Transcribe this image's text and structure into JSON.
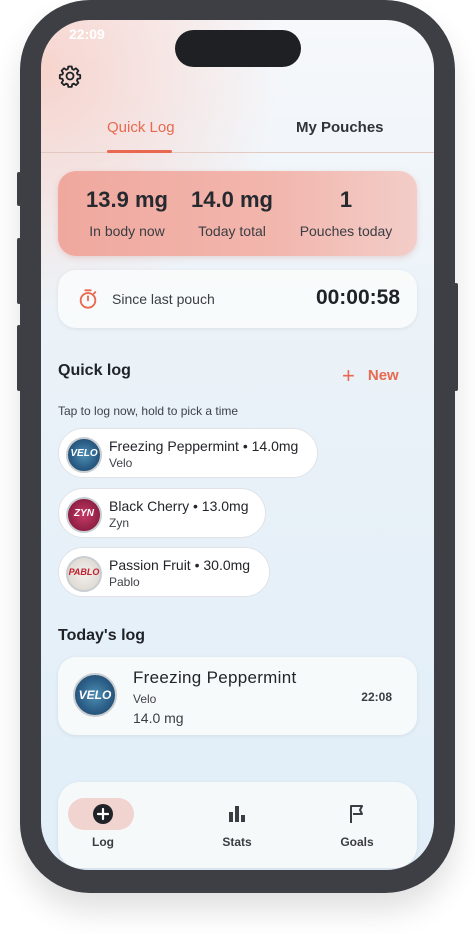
{
  "statusbar": {
    "time": "22:09",
    "indicators": ""
  },
  "header": {
    "settings_icon": "gear-icon"
  },
  "tabs": [
    {
      "label": "Quick Log",
      "active": true
    },
    {
      "label": "My Pouches",
      "active": false
    }
  ],
  "stats": [
    {
      "value": "13.9 mg",
      "label": "In body now"
    },
    {
      "value": "14.0 mg",
      "label": "Today total"
    },
    {
      "value": "1",
      "label": "Pouches today"
    }
  ],
  "timer": {
    "icon": "stopwatch-icon",
    "label": "Since last pouch",
    "value": "00:00:58"
  },
  "quick_log": {
    "title": "Quick log",
    "new_label": "New",
    "hint": "Tap to log now, hold to pick a time",
    "items": [
      {
        "name": "Freezing Peppermint • 14.0mg",
        "brand": "Velo",
        "logo_text": "VELO"
      },
      {
        "name": "Black Cherry • 13.0mg",
        "brand": "Zyn",
        "logo_text": "ZYN"
      },
      {
        "name": "Passion Fruit • 30.0mg",
        "brand": "Pablo",
        "logo_text": "PABLO"
      }
    ]
  },
  "todays_log": {
    "title": "Today's log",
    "entries": [
      {
        "name": "Freezing Peppermint",
        "brand": "Velo",
        "dose": "14.0 mg",
        "time": "22:08",
        "logo_text": "VELO"
      }
    ]
  },
  "bottom_nav": [
    {
      "label": "Log",
      "icon": "add-circle-icon",
      "active": true
    },
    {
      "label": "Stats",
      "icon": "bar-chart-icon",
      "active": false
    },
    {
      "label": "Goals",
      "icon": "flag-icon",
      "active": false
    }
  ],
  "colors": {
    "accent": "#e8694f",
    "frame": "#3d3f44",
    "stats_card": "#f0a89e"
  }
}
